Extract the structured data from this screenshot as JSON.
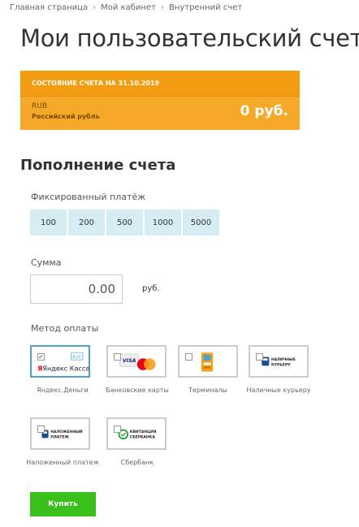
{
  "breadcrumb": [
    "Главная страница",
    "Мой кабинет",
    "Внутренний счет"
  ],
  "page_title": "Мои пользовательский счет",
  "state": {
    "header": "Состояние счета на 31.10.2019",
    "currency_code": "RUB",
    "currency_name": "Российский рубль",
    "balance": "0 руб."
  },
  "topup": {
    "title": "Пополнение счета",
    "fixed_label": "Фиксированный платёж",
    "amounts": [
      "100",
      "200",
      "500",
      "1000",
      "5000"
    ],
    "sum_label": "Сумма",
    "sum_value": "0.00",
    "sum_unit": "руб.",
    "method_label": "Метод оплаты",
    "methods": [
      {
        "caption": "Яндекс.Деньги",
        "logo_text": "Яндекс Касса",
        "logo_badge": "B2C",
        "checked": true
      },
      {
        "caption": "Банковские карты",
        "logo_text": "VISA",
        "checked": false
      },
      {
        "caption": "Терминалы",
        "logo_text": "",
        "checked": false
      },
      {
        "caption": "Наличные курьеру",
        "logo_text": "НАЛИЧНЫЕ КУРЬЕРУ",
        "checked": false
      },
      {
        "caption": "Наложенный платеж",
        "logo_text": "НАЛОЖЕННЫЙ ПЛАТЕЖ",
        "checked": false
      },
      {
        "caption": "Сбербанк",
        "logo_text": "КВИТАНЦИЯ СБЕРБАНКА",
        "checked": false
      }
    ],
    "buy_label": "Купить"
  },
  "colors": {
    "accent": "#f39c12",
    "selected_border": "#4aa3c8",
    "buy": "#39c01b",
    "amount_bg": "#d4ecf2"
  }
}
